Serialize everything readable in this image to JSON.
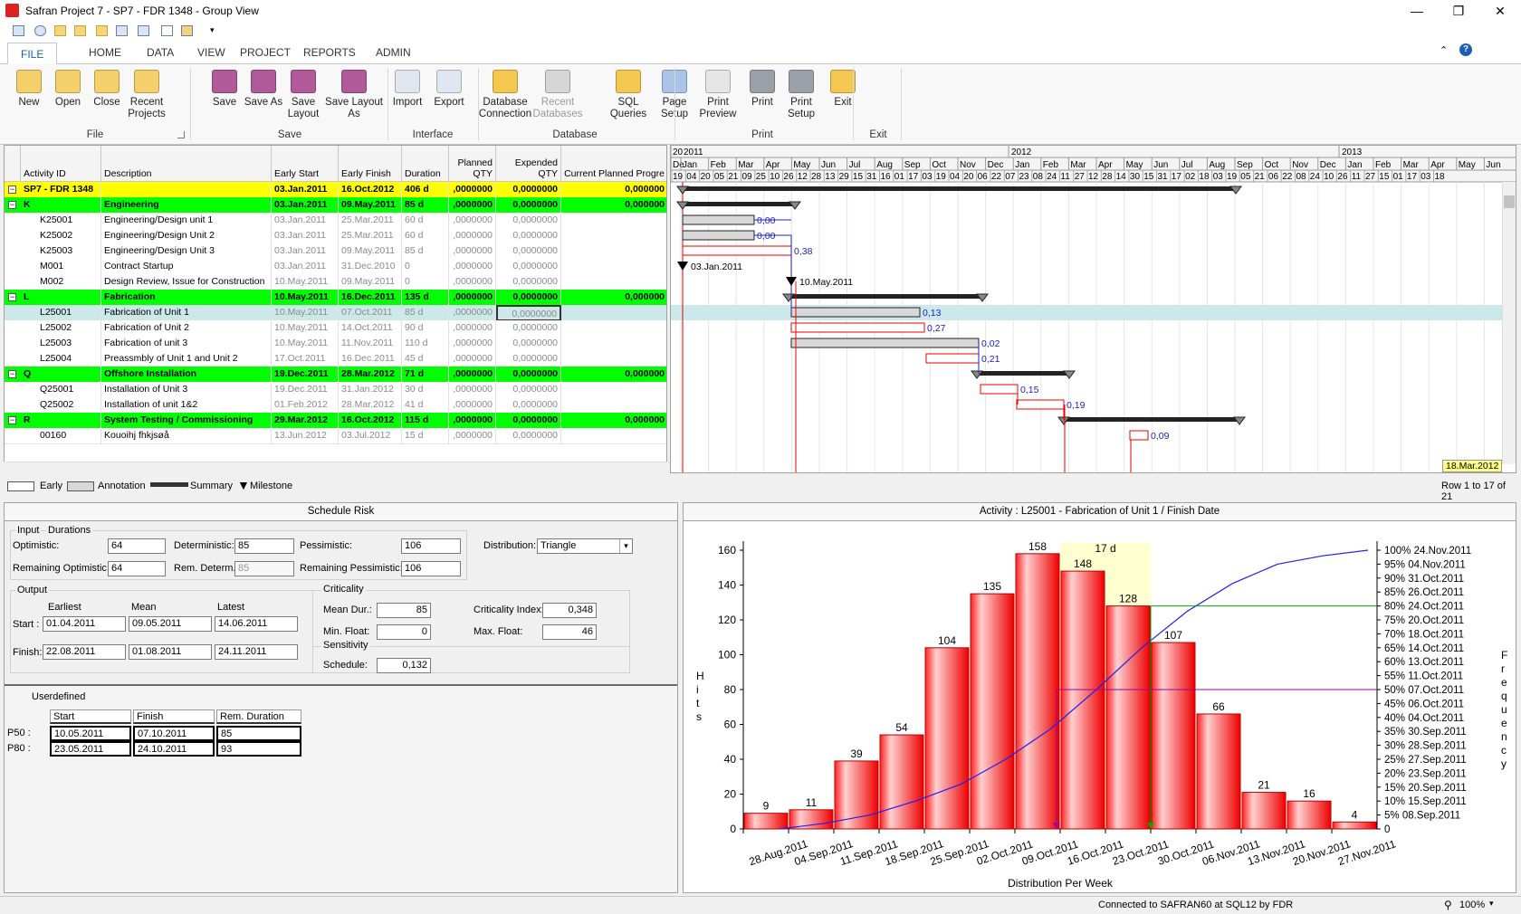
{
  "window": {
    "title": "Safran Project 7 - SP7 - FDR 1348 - Group View",
    "minimize": "—",
    "restore": "❐",
    "close": "✕"
  },
  "tabs": [
    "FILE",
    "HOME",
    "DATA",
    "VIEW",
    "PROJECT",
    "REPORTS",
    "ADMIN"
  ],
  "ribbon": {
    "buttons": [
      {
        "label": "New",
        "icon": "new-file-icon"
      },
      {
        "label": "Open",
        "icon": "open-folder-icon"
      },
      {
        "label": "Close",
        "icon": "close-folder-icon"
      },
      {
        "label": "Recent\nProjects",
        "icon": "recent-projects-icon"
      },
      {
        "label": "Save",
        "icon": "save-icon"
      },
      {
        "label": "Save As",
        "icon": "save-as-icon"
      },
      {
        "label": "Save\nLayout",
        "icon": "save-layout-icon"
      },
      {
        "label": "Save Layout\nAs",
        "icon": "save-layout-as-icon"
      },
      {
        "label": "Import",
        "icon": "import-icon"
      },
      {
        "label": "Export",
        "icon": "export-icon"
      },
      {
        "label": "Database\nConnection",
        "icon": "database-connection-icon"
      },
      {
        "label": "Recent\nDatabases",
        "icon": "recent-databases-icon",
        "disabled": true
      },
      {
        "label": "SQL\nQueries",
        "icon": "sql-queries-icon"
      },
      {
        "label": "Page\nSetup",
        "icon": "page-setup-icon"
      },
      {
        "label": "Print\nPreview",
        "icon": "print-preview-icon"
      },
      {
        "label": "Print",
        "icon": "print-icon"
      },
      {
        "label": "Print\nSetup",
        "icon": "print-setup-icon"
      },
      {
        "label": "Exit",
        "icon": "exit-icon"
      }
    ],
    "groups": [
      "File",
      "Save",
      "Interface",
      "Database",
      "Print",
      "Exit"
    ]
  },
  "grid": {
    "headers": [
      "Activity ID",
      "Description",
      "Early Start",
      "Early Finish",
      "Duration",
      "Planned QTY",
      "Expended QTY",
      "Current Planned Progre"
    ],
    "rows": [
      {
        "type": "project",
        "id": "SP7 - FDR 1348",
        "desc": "",
        "es": "03.Jan.2011",
        "ef": "16.Oct.2012",
        "dur": "406 d",
        "pq": ",0000000",
        "eq": "0,0000000",
        "cp": "0,000000"
      },
      {
        "type": "group",
        "id": "K",
        "desc": "Engineering",
        "es": "03.Jan.2011",
        "ef": "09.May.2011",
        "dur": "85 d",
        "pq": ",0000000",
        "eq": "0,0000000",
        "cp": "0,000000"
      },
      {
        "type": "act",
        "id": "K25001",
        "desc": "Engineering/Design unit 1",
        "es": "03.Jan.2011",
        "ef": "25.Mar.2011",
        "dur": "60 d",
        "pq": ",0000000",
        "eq": "0,0000000",
        "cp": ""
      },
      {
        "type": "act",
        "id": "K25002",
        "desc": "Engineering/Design Unit 2",
        "es": "03.Jan.2011",
        "ef": "25.Mar.2011",
        "dur": "60 d",
        "pq": ",0000000",
        "eq": "0,0000000",
        "cp": ""
      },
      {
        "type": "act",
        "id": "K25003",
        "desc": "Engineering/Design Unit 3",
        "es": "03.Jan.2011",
        "ef": "09.May.2011",
        "dur": "85 d",
        "pq": ",0000000",
        "eq": "0,0000000",
        "cp": ""
      },
      {
        "type": "act",
        "id": "M001",
        "desc": "Contract Startup",
        "es": "03.Jan.2011",
        "ef": "31.Dec.2010",
        "dur": "0",
        "pq": ",0000000",
        "eq": "0,0000000",
        "cp": ""
      },
      {
        "type": "act",
        "id": "M002",
        "desc": "Design Review, Issue for Construction",
        "es": "10.May.2011",
        "ef": "09.May.2011",
        "dur": "0",
        "pq": ",0000000",
        "eq": "0,0000000",
        "cp": ""
      },
      {
        "type": "group",
        "id": "L",
        "desc": "Fabrication",
        "es": "10.May.2011",
        "ef": "16.Dec.2011",
        "dur": "135 d",
        "pq": ",0000000",
        "eq": "0,0000000",
        "cp": "0,000000"
      },
      {
        "type": "sel",
        "id": "L25001",
        "desc": "Fabrication of Unit 1",
        "es": "10.May.2011",
        "ef": "07.Oct.2011",
        "dur": "85 d",
        "pq": ",0000000",
        "eq": "0,0000000",
        "cp": ""
      },
      {
        "type": "act",
        "id": "L25002",
        "desc": "Fabrication of Unit 2",
        "es": "10.May.2011",
        "ef": "14.Oct.2011",
        "dur": "90 d",
        "pq": ",0000000",
        "eq": "0,0000000",
        "cp": ""
      },
      {
        "type": "act",
        "id": "L25003",
        "desc": "Fabrication of unit 3",
        "es": "10.May.2011",
        "ef": "11.Nov.2011",
        "dur": "110 d",
        "pq": ",0000000",
        "eq": "0,0000000",
        "cp": ""
      },
      {
        "type": "act",
        "id": "L25004",
        "desc": "Preassmbly of Unit 1 and Unit 2",
        "es": "17.Oct.2011",
        "ef": "16.Dec.2011",
        "dur": "45 d",
        "pq": ",0000000",
        "eq": "0,0000000",
        "cp": ""
      },
      {
        "type": "group",
        "id": "Q",
        "desc": "Offshore Installation",
        "es": "19.Dec.2011",
        "ef": "28.Mar.2012",
        "dur": "71 d",
        "pq": ",0000000",
        "eq": "0,0000000",
        "cp": "0,000000"
      },
      {
        "type": "act",
        "id": "Q25001",
        "desc": "Installation of Unit 3",
        "es": "19.Dec.2011",
        "ef": "31.Jan.2012",
        "dur": "30 d",
        "pq": ",0000000",
        "eq": "0,0000000",
        "cp": ""
      },
      {
        "type": "act",
        "id": "Q25002",
        "desc": "Installation of unit 1&2",
        "es": "01.Feb.2012",
        "ef": "28.Mar.2012",
        "dur": "41 d",
        "pq": ",0000000",
        "eq": "0,0000000",
        "cp": ""
      },
      {
        "type": "group",
        "id": "R",
        "desc": "System Testing / Commissioning",
        "es": "29.Mar.2012",
        "ef": "16.Oct.2012",
        "dur": "115 d",
        "pq": ",0000000",
        "eq": "0,0000000",
        "cp": "0,000000"
      },
      {
        "type": "act",
        "id": "00160",
        "desc": "Kouoihj fhkjsøå",
        "es": "13.Jun.2012",
        "ef": "03.Jul.2012",
        "dur": "15 d",
        "pq": ",0000000",
        "eq": "0,0000000",
        "cp": ""
      }
    ]
  },
  "gantt": {
    "years": [
      "2011",
      "2012",
      "2013"
    ],
    "months": [
      "De",
      "Jan",
      "Feb",
      "Mar",
      "Apr",
      "May",
      "Jun",
      "Jul",
      "Aug",
      "Sep",
      "Oct",
      "Nov",
      "Dec",
      "Jan",
      "Feb",
      "Mar",
      "Apr",
      "May",
      "Jun",
      "Jul",
      "Aug",
      "Sep",
      "Oct",
      "Nov",
      "Dec",
      "Jan",
      "Feb",
      "Mar",
      "Apr",
      "May",
      "Jun"
    ],
    "days": [
      "19",
      "04",
      "20",
      "05",
      "21",
      "09",
      "25",
      "10",
      "26",
      "12",
      "28",
      "13",
      "29",
      "15",
      "31",
      "16",
      "01",
      "17",
      "03",
      "19",
      "04",
      "20",
      "06",
      "22",
      "07",
      "23",
      "08",
      "24",
      "11",
      "27",
      "12",
      "28",
      "14",
      "30",
      "15",
      "31",
      "17",
      "02",
      "18",
      "03",
      "19",
      "05",
      "21",
      "06",
      "22",
      "08",
      "24",
      "10",
      "26",
      "11",
      "27",
      "15",
      "01",
      "17",
      "03",
      "18"
    ],
    "year_prefix": "20",
    "float_labels": [
      "0,00",
      "0,00",
      "0,38",
      "0,13",
      "0,27",
      "0,02",
      "0,21",
      "0,15",
      "0,19",
      "0,09"
    ],
    "milestone_labels": [
      "03.Jan.2011",
      "10.May.2011"
    ],
    "date_tag": "18.Mar.2012",
    "row_info": "Row 1 to 17 of 21"
  },
  "legend": [
    "Early",
    "Annotation",
    "Summary",
    "Milestone"
  ],
  "risk": {
    "title": "Schedule Risk",
    "input_label": "Input",
    "durations_label": "Durations",
    "optimistic_label": "Optimistic:",
    "optimistic": "64",
    "deterministic_label": "Deterministic:",
    "deterministic": "85",
    "pessimistic_label": "Pessimistic:",
    "pessimistic": "106",
    "rem_opt_label": "Remaining Optimistic:",
    "rem_opt": "64",
    "rem_det_label": "Rem. Determ.",
    "rem_det": "85",
    "rem_pes_label": "Remaining Pessimistic:",
    "rem_pes": "106",
    "distribution_label": "Distribution:",
    "distribution": "Triangle",
    "output_label": "Output",
    "col_earliest": "Earliest",
    "col_mean": "Mean",
    "col_latest": "Latest",
    "start_label": "Start :",
    "start": [
      "01.04.2011",
      "09.05.2011",
      "14.06.2011"
    ],
    "finish_label": "Finish:",
    "finish": [
      "22.08.2011",
      "01.08.2011",
      "24.11.2011"
    ],
    "criticality_label": "Criticality",
    "mean_dur_label": "Mean Dur.:",
    "mean_dur": "85",
    "min_float_label": "Min. Float:",
    "min_float": "0",
    "crit_index_label": "Criticality Index:",
    "crit_index": "0,348",
    "max_float_label": "Max. Float:",
    "max_float": "46",
    "sensitivity_label": "Sensitivity",
    "schedule_label": "Schedule:",
    "schedule": "0,132",
    "userdefined_label": "Userdefined",
    "ud_headers": [
      "Start",
      "Finish",
      "Rem. Duration"
    ],
    "ud_rows": [
      {
        "label": "P50 :",
        "start": "10.05.2011",
        "finish": "07.10.2011",
        "rem": "85"
      },
      {
        "label": "P80 :",
        "start": "23.05.2011",
        "finish": "24.10.2011",
        "rem": "93"
      }
    ]
  },
  "chart_data": {
    "type": "bar",
    "title": "Activity : L25001 - Fabrication of Unit 1 / Finish Date",
    "xlabel": "Distribution Per Week",
    "ylabel": "Hits",
    "y2label": "Frequency",
    "ylim": [
      0,
      160
    ],
    "yticks": [
      0,
      20,
      40,
      60,
      80,
      100,
      120,
      140,
      160
    ],
    "categories": [
      "28.Aug.2011",
      "04.Sep.2011",
      "11.Sep.2011",
      "18.Sep.2011",
      "25.Sep.2011",
      "02.Oct.2011",
      "09.Oct.2011",
      "16.Oct.2011",
      "23.Oct.2011",
      "30.Oct.2011",
      "06.Nov.2011",
      "13.Nov.2011",
      "20.Nov.2011",
      "27.Nov.2011"
    ],
    "values": [
      9,
      11,
      39,
      54,
      104,
      135,
      158,
      148,
      128,
      107,
      66,
      21,
      16,
      4
    ],
    "highlight_label": "17 d",
    "cumulative": [
      0,
      2,
      5,
      10,
      16,
      25,
      36,
      50,
      65,
      78,
      88,
      95,
      98,
      100
    ],
    "frequency_ticks": [
      {
        "pct": "100%",
        "date": "24.Nov.2011"
      },
      {
        "pct": "95%",
        "date": "04.Nov.2011"
      },
      {
        "pct": "90%",
        "date": "31.Oct.2011"
      },
      {
        "pct": "85%",
        "date": "26.Oct.2011"
      },
      {
        "pct": "80%",
        "date": "24.Oct.2011"
      },
      {
        "pct": "75%",
        "date": "20.Oct.2011"
      },
      {
        "pct": "70%",
        "date": "18.Oct.2011"
      },
      {
        "pct": "65%",
        "date": "14.Oct.2011"
      },
      {
        "pct": "60%",
        "date": "13.Oct.2011"
      },
      {
        "pct": "55%",
        "date": "11.Oct.2011"
      },
      {
        "pct": "50%",
        "date": "07.Oct.2011"
      },
      {
        "pct": "45%",
        "date": "06.Oct.2011"
      },
      {
        "pct": "40%",
        "date": "04.Oct.2011"
      },
      {
        "pct": "35%",
        "date": "30.Sep.2011"
      },
      {
        "pct": "30%",
        "date": "28.Sep.2011"
      },
      {
        "pct": "25%",
        "date": "27.Sep.2011"
      },
      {
        "pct": "20%",
        "date": "23.Sep.2011"
      },
      {
        "pct": "15%",
        "date": "20.Sep.2011"
      },
      {
        "pct": "10%",
        "date": "15.Sep.2011"
      },
      {
        "pct": "5%",
        "date": "08.Sep.2011"
      },
      {
        "pct": "0",
        "date": ""
      }
    ]
  },
  "status": {
    "text": "Connected to SAFRAN60 at SQL12 by FDR",
    "zoom": "100%"
  },
  "colors": {
    "project_row": "#ffff00",
    "group_row": "#00ff00",
    "selected_row": "#cce8ea",
    "bar_red": "#ff0000",
    "accent_blue": "#1a5fb4"
  }
}
